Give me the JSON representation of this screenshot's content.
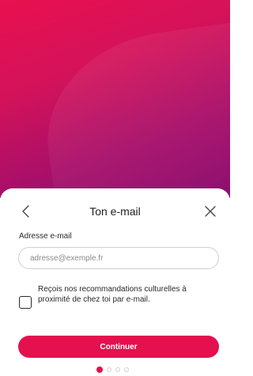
{
  "colors": {
    "accent": "#e5104e",
    "hero_gradient_start": "#e8104f",
    "hero_gradient_end": "#8a0b6e"
  },
  "header": {
    "back_icon": "chevron-left-icon",
    "title": "Ton e-mail",
    "close_icon": "close-icon"
  },
  "form": {
    "email_label": "Adresse e-mail",
    "email_value": "",
    "email_placeholder": "adresse@exemple.fr",
    "consent_text": "Reçois nos recommandations culturelles à proximité de chez toi par e-mail.",
    "consent_checked": false,
    "continue_label": "Continuer"
  },
  "pagination": {
    "total_steps": 4,
    "current_step": 1
  }
}
